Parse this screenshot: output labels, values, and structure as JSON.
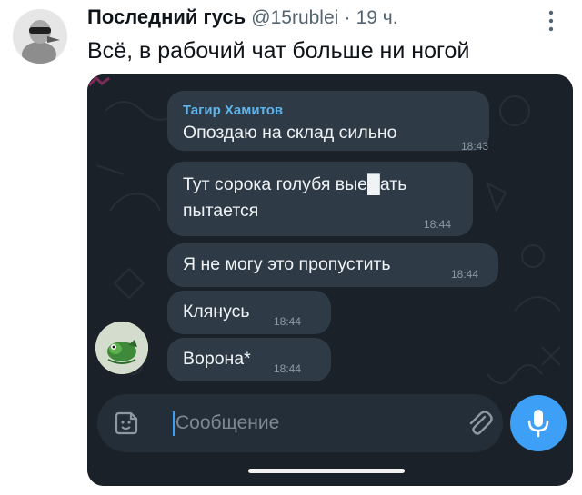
{
  "tweet": {
    "display_name": "Последний гусь",
    "handle": "@15rublei",
    "separator": "·",
    "time_ago": "19 ч.",
    "text": "Всё, в рабочий чат больше ни ногой"
  },
  "chat": {
    "sender_name": "Тагир Хамитов",
    "messages": [
      {
        "text": "Опоздаю на склад сильно",
        "time": "18:43"
      },
      {
        "text_line1": "Тут сорока голубя вые█ать",
        "text_line2": "пытается",
        "time": "18:44"
      },
      {
        "text": "Я не могу это пропустить",
        "time": "18:44"
      },
      {
        "text": "Клянусь",
        "time": "18:44"
      },
      {
        "text": "Ворона*",
        "time": "18:44"
      }
    ],
    "input": {
      "placeholder": "Сообщение",
      "value": ""
    },
    "icons": {
      "sticker": "sticker-icon",
      "attach": "paperclip-icon",
      "mic": "microphone-icon",
      "more": "more-vertical-icon"
    }
  },
  "colors": {
    "chat_bg": "#1b2128",
    "bubble": "#2e3b47",
    "sender_name": "#5fb3e8",
    "accent": "#3d9ff5"
  }
}
